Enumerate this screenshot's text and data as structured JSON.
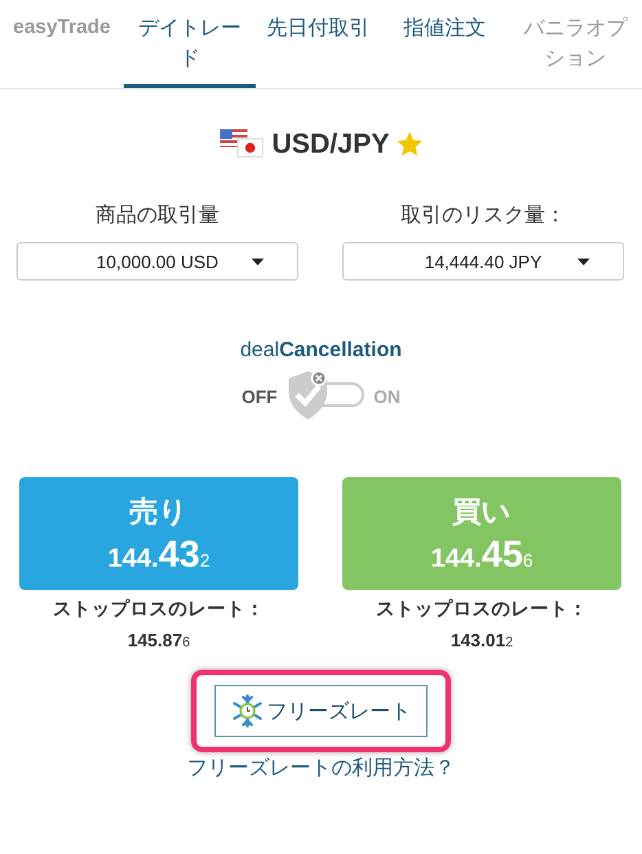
{
  "tabs": [
    {
      "label": "easyTrade",
      "selected": false,
      "disabled": true
    },
    {
      "label": "デイトレード",
      "selected": true,
      "disabled": false
    },
    {
      "label": "先日付取引",
      "selected": false,
      "disabled": false
    },
    {
      "label": "指値注文",
      "selected": false,
      "disabled": false
    },
    {
      "label": "バニラオプション",
      "selected": false,
      "disabled": true
    }
  ],
  "instrument": {
    "symbol": "USD/JPY",
    "favorite": true
  },
  "amounts": [
    {
      "label": "商品の取引量",
      "value": "10,000.00 USD"
    },
    {
      "label": "取引のリスク量：",
      "value": "14,444.40 JPY"
    }
  ],
  "deal_cancellation": {
    "title": "deal**Cancellation**",
    "off_label": "OFF",
    "on_label": "ON",
    "on": false
  },
  "trades": [
    {
      "kind": "sell",
      "label": "売り",
      "price": "144.**43**$_{2}$",
      "stop_label": "ストップロスのレート：",
      "stop_rate": "145.87$_{6}$"
    },
    {
      "kind": "buy",
      "label": "買い",
      "price": "144.**45**$_{6}$",
      "stop_label": "ストップロスのレート：",
      "stop_rate": "143.01$_{2}$"
    }
  ],
  "freeze": {
    "label": "フリーズレート",
    "highlighted": true
  },
  "help_link": "フリーズレートの利用方法？"
}
